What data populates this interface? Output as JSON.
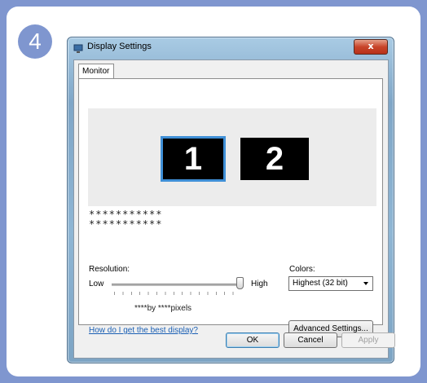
{
  "step": {
    "number": "4"
  },
  "window": {
    "title": "Display Settings",
    "close_label": "x"
  },
  "tabs": [
    {
      "label": "Monitor"
    }
  ],
  "monitors": [
    {
      "label": "1",
      "selected": true
    },
    {
      "label": "2",
      "selected": false
    }
  ],
  "display_info": {
    "line1": "***********",
    "line2": "***********"
  },
  "resolution": {
    "label": "Resolution:",
    "low_label": "Low",
    "high_label": "High",
    "value_text": "****by ****pixels",
    "slider_level": 1.0
  },
  "colors": {
    "label": "Colors:",
    "selected": "Highest (32 bit)"
  },
  "links": {
    "help": "How do I get the best display?"
  },
  "buttons": {
    "advanced": "Advanced Settings...",
    "ok": "OK",
    "cancel": "Cancel",
    "apply": "Apply"
  },
  "colors_theme": {
    "frame_accent": "#7f96cf",
    "selection_border": "#3f8fd6",
    "link": "#1a5fb4"
  }
}
